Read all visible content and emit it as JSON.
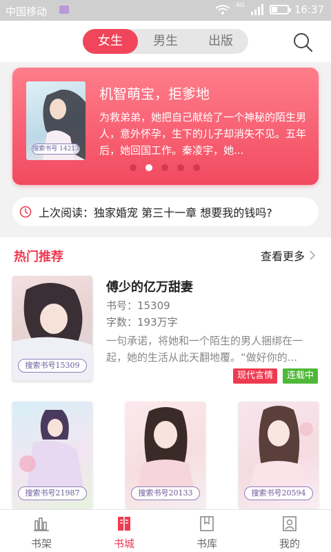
{
  "status_bar": {
    "carrier": "中国移动",
    "network": "4G",
    "time": "16:37"
  },
  "top_tabs": {
    "items": [
      "女生",
      "男生",
      "出版"
    ],
    "active": "女生"
  },
  "banner": {
    "title": "机智萌宝，拒爹地",
    "desc": "为救弟弟，她把自己献给了一个神秘的陌生男人，意外怀孕，生下的儿子却消失不见。五年后，她回国工作。秦凌宇，她...",
    "cover_no": "搜索书号 14213",
    "dots_total": 5,
    "dots_active": 2
  },
  "last_read": {
    "label": "上次阅读：",
    "text": "独家婚宠 第三十一章 想要我的钱吗?"
  },
  "hot": {
    "title": "热门推荐",
    "more": "查看更多",
    "featured": {
      "title": "傅少的亿万甜妻",
      "book_no": "书号：15309",
      "words": "字数：193万字",
      "desc": "一句承诺，将她和一个陌生的男人捆绑在一起，她的生活从此天翻地覆。“做好你的...",
      "cover_no": "搜索书号15309",
      "genre": "现代言情",
      "status": "连载中"
    },
    "grid": [
      {
        "cover_no": "搜索书号21987"
      },
      {
        "cover_no": "搜索书号20133"
      },
      {
        "cover_no": "搜索书号20594"
      }
    ]
  },
  "tabbar": {
    "items": [
      "书架",
      "书城",
      "书库",
      "我的"
    ],
    "active": "书城"
  },
  "colors": {
    "accent": "#ee3a50",
    "banner": "#f24a60",
    "status_tag": "#4fb838"
  }
}
